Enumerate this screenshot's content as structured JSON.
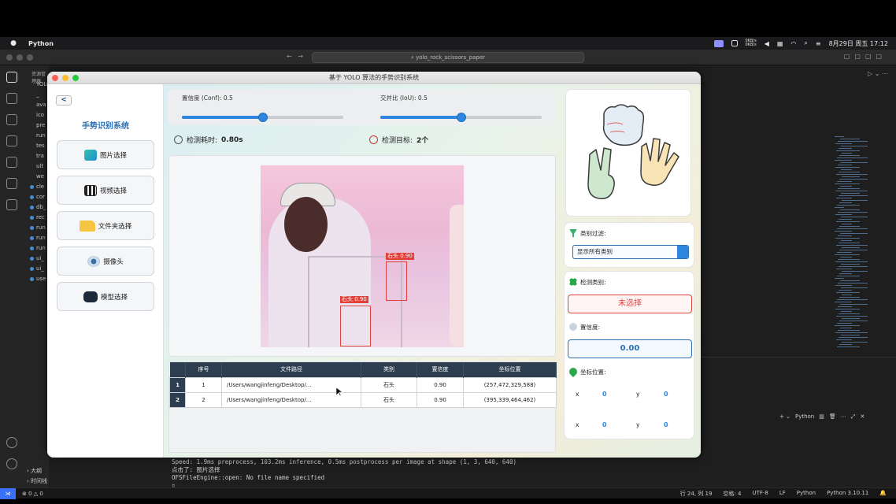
{
  "menubar": {
    "app_name": "Python",
    "date_time": "8月29日 周五  17:12",
    "network": "0KB/s\n0KB/s"
  },
  "vscode": {
    "search": "yolo_rock_scissors_paper",
    "explorer_header": "资源管理器",
    "explorer_items": [
      "YOLO",
      "_",
      "ava",
      "ico",
      "pre",
      "run",
      "tes",
      "tra",
      "ult",
      "we",
      "cle",
      "cor",
      "db_",
      "rec",
      "run",
      "run",
      "run",
      "ui_",
      "ui_",
      "use"
    ],
    "explorer_bottom": [
      "大纲",
      "时间线"
    ],
    "terminal_lines": [
      "Speed: 1.9ms preprocess, 103.2ms inference, 0.5ms postprocess per image at shape (1, 3, 640, 640)",
      "点击了: 图片选择",
      "OFSFileEngine::open: No file name specified",
      "▯"
    ],
    "terminal_tab": "Python",
    "status": {
      "errors": "⊗ 0 △ 0",
      "position": "行 24, 列 19",
      "spaces": "空格: 4",
      "encoding": "UTF-8",
      "eol": "LF",
      "language": "Python",
      "interpreter": "Python 3.10.11"
    }
  },
  "app": {
    "window_title": "基于 YOLO 算法的手势识别系统",
    "back_label": "<",
    "side_title": "手势识别系统",
    "buttons": {
      "image": "图片选择",
      "video": "视频选择",
      "folder": "文件夹选择",
      "camera": "摄像头",
      "model": "模型选择"
    },
    "conf_label": "置信度 (Conf): 0.5",
    "iou_label": "交并比 (IoU): 0.5",
    "conf_value": 0.5,
    "iou_value": 0.5,
    "time_label": "检测耗时: ",
    "time_value": "0.80s",
    "target_label": "检测目标: ",
    "target_value": "2个",
    "detections": [
      {
        "label": "石头 0.90"
      },
      {
        "label": "石头 0.90"
      }
    ],
    "table": {
      "headers": [
        "序号",
        "文件路径",
        "类别",
        "置信度",
        "坐标位置"
      ],
      "rows": [
        {
          "row_num": "1",
          "index": "1",
          "path": "/Users/wangjinfeng/Desktop/...",
          "cls": "石头",
          "conf": "0.90",
          "box": "(257,472,329,588)"
        },
        {
          "row_num": "2",
          "index": "2",
          "path": "/Users/wangjinfeng/Desktop/...",
          "cls": "石头",
          "conf": "0.90",
          "box": "(395,339,464,462)"
        }
      ]
    },
    "filter": {
      "title": "类别过滤:",
      "selected": "显示所有类别"
    },
    "detect_class": {
      "title": "检测类别:",
      "value": "未选择"
    },
    "confidence": {
      "title": "置信度:",
      "value": "0.00"
    },
    "coords": {
      "title": "坐标位置:",
      "x_label": "x",
      "y_label": "y",
      "x1": "0",
      "y1": "0",
      "x2": "0",
      "y2": "0"
    }
  },
  "colors": {
    "accent": "#2e86de",
    "header": "#2c3e50",
    "danger": "#e2403a"
  }
}
